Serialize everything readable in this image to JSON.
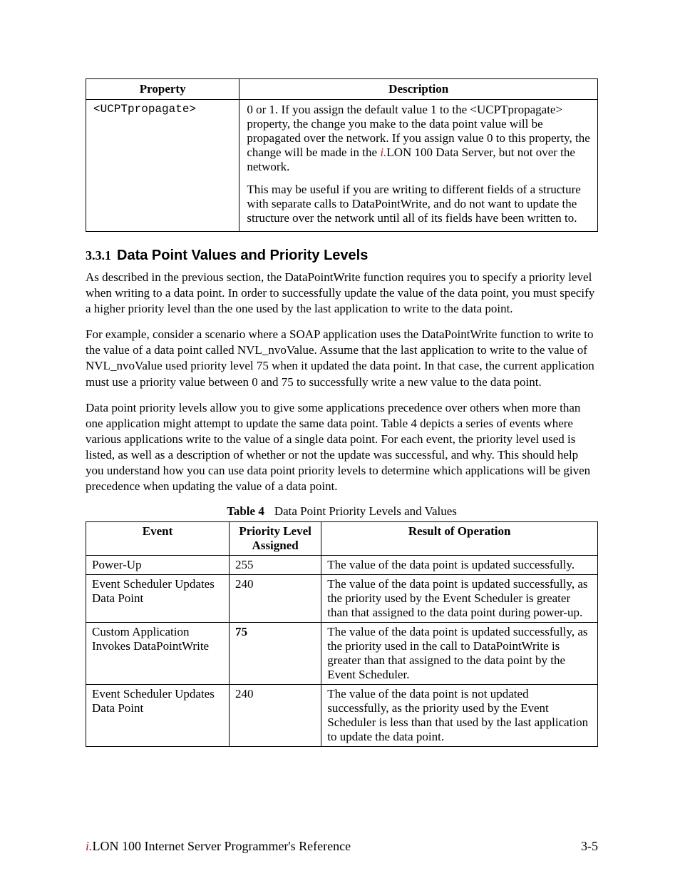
{
  "top_table": {
    "headers": [
      "Property",
      "Description"
    ],
    "row": {
      "property": "<UCPTpropagate>",
      "desc_p1_a": "0 or 1. If you assign the default value 1 to the <UCPTpropagate> property, the change you make to the data point value will be propagated over the network. If you assign value 0 to this property, the change will be made in the ",
      "desc_p1_ital": "i.",
      "desc_p1_b": "LON 100 Data Server, but not over the network.",
      "desc_p2": "This may be useful if you are writing to different fields of a structure with separate calls to DataPointWrite, and do not want to update the structure over the network until all of its fields have been written to."
    }
  },
  "section": {
    "num": "3.3.1",
    "title": "Data Point Values and Priority Levels"
  },
  "paragraphs": {
    "p1": "As described in the previous section, the DataPointWrite function requires you to specify a priority level when writing to a data point. In order to successfully update the value of the data point, you must specify a higher priority level than the one used by the last application to write to the data point.",
    "p2": "For example, consider a scenario where a SOAP application uses the DataPointWrite function to write to the value of a data point called NVL_nvoValue. Assume that the last application to write to the value of NVL_nvoValue used priority level 75 when it updated the data point. In that case, the current application must use a priority value between 0 and 75 to successfully write a new value to the data point.",
    "p3": "Data point priority levels allow you to give some applications precedence over others when more than one application might attempt to update the same data point. Table 4 depicts a series of events where various applications write to the value of a single data point. For each event, the priority level used is listed, as well as a description of whether or not the update was successful, and why. This should help you understand how you can use data point priority levels to determine which applications will be given precedence when updating the value of a data point."
  },
  "table_caption": {
    "num": "Table 4",
    "text": "Data Point Priority Levels and Values"
  },
  "data_table": {
    "headers": [
      "Event",
      "Priority Level Assigned",
      "Result of Operation"
    ],
    "rows": [
      {
        "event": "Power-Up",
        "priority": "255",
        "result": "The value of the data point is updated successfully."
      },
      {
        "event": "Event Scheduler Updates Data Point",
        "priority": "240",
        "result": "The value of the data point is updated successfully, as the priority used by the Event Scheduler is greater than that assigned to the data point during power-up."
      },
      {
        "event": "Custom Application Invokes DataPointWrite",
        "priority": "75",
        "priority_bold": true,
        "result": "The value of the data point is updated successfully, as the priority used in the call to DataPointWrite is greater than that assigned to the data point by the Event Scheduler."
      },
      {
        "event": "Event Scheduler Updates Data Point",
        "priority": "240",
        "result": "The value of the data point is not updated successfully, as the priority used by the Event Scheduler is less than that used by the last application to update the data point."
      }
    ]
  },
  "footer": {
    "ital": "i.",
    "title": "LON 100 Internet Server Programmer's Reference",
    "page": "3-5"
  }
}
